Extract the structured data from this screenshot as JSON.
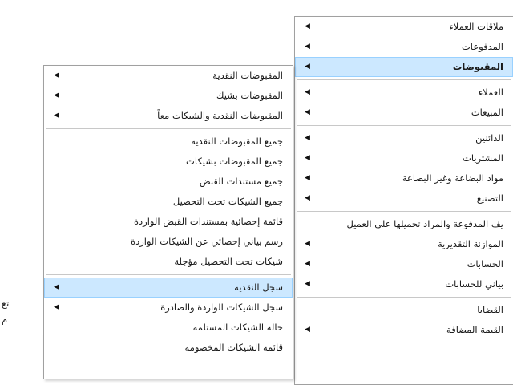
{
  "main_menu": {
    "items": [
      {
        "label": "ملاقات العملاء",
        "arrow": "◀",
        "sep_after": false
      },
      {
        "label": "المدفوعات",
        "arrow": "◀",
        "sep_after": false
      },
      {
        "label": "المقبوضات",
        "arrow": "◀",
        "highlight": true,
        "bold": true,
        "sep_after": true
      },
      {
        "label": "العملاء",
        "arrow": "◀",
        "sep_after": false
      },
      {
        "label": "المبيعات",
        "arrow": "◀",
        "sep_after": true
      },
      {
        "label": "الدائنين",
        "arrow": "◀",
        "sep_after": false
      },
      {
        "label": "المشتريات",
        "arrow": "◀",
        "sep_after": false
      },
      {
        "label": "مواد البضاعة وغير البضاعة",
        "arrow": "◀",
        "sep_after": false
      },
      {
        "label": "التصنيع",
        "arrow": "◀",
        "sep_after": true
      },
      {
        "label": "يف المدفوعة والمراد تحميلها على العميل",
        "arrow": "",
        "sep_after": false
      },
      {
        "label": "الموازنة التقديرية",
        "arrow": "◀",
        "sep_after": false
      },
      {
        "label": "الحسابات",
        "arrow": "◀",
        "sep_after": false
      },
      {
        "label": "بياني للحسابات",
        "arrow": "◀",
        "sep_after": true
      },
      {
        "label": "القضايا",
        "arrow": "",
        "sep_after": false
      },
      {
        "label": "القيمة المضافة",
        "arrow": "◀",
        "sep_after": false
      }
    ]
  },
  "receipts_menu": {
    "items": [
      {
        "label": "المقبوضات النقدية",
        "arrow": "◀",
        "sep_after": false
      },
      {
        "label": "المقبوضات بشيك",
        "arrow": "◀",
        "sep_after": false
      },
      {
        "label": "المقبوضات النقدية والشيكات معاً",
        "arrow": "◀",
        "sep_after": true
      },
      {
        "label": "جميع المقبوضات النقدية",
        "arrow": "",
        "sep_after": false
      },
      {
        "label": "جميع المقبوضات بشيكات",
        "arrow": "",
        "sep_after": false
      },
      {
        "label": "جميع مستندات القبض",
        "arrow": "",
        "sep_after": false
      },
      {
        "label": "جميع الشيكات تحت التحصيل",
        "arrow": "",
        "sep_after": false
      },
      {
        "label": "قائمة إحصائية بمستندات القبض الواردة",
        "arrow": "",
        "sep_after": false
      },
      {
        "label": "رسم بياني إحصائي عن الشيكات الواردة",
        "arrow": "",
        "sep_after": false
      },
      {
        "label": "شيكات تحت التحصيل مؤجلة",
        "arrow": "",
        "sep_after": true
      },
      {
        "label": "سجل النقدية",
        "arrow": "◀",
        "highlight": true,
        "sep_after": false
      },
      {
        "label": "سجل الشيكات الواردة والصادرة",
        "arrow": "◀",
        "sep_after": false
      },
      {
        "label": "حالة الشيكات المستلمة",
        "arrow": "",
        "sep_after": false
      },
      {
        "label": "قائمة الشيكات المخصومة",
        "arrow": "",
        "sep_after": false
      }
    ]
  },
  "back_menu": {
    "items": [
      {
        "label": "تع"
      },
      {
        "label": "م"
      }
    ]
  }
}
